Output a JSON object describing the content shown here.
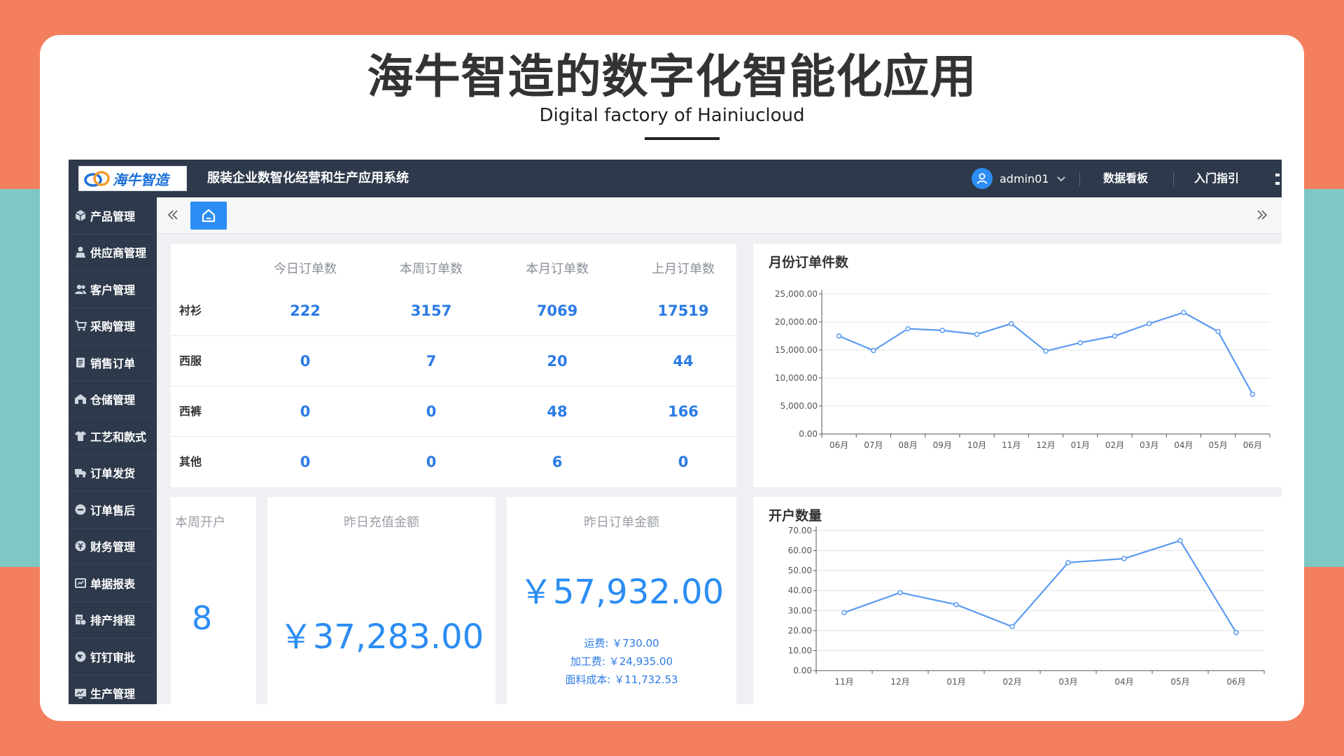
{
  "slide": {
    "headline": "海牛智造的数字化智能化应用",
    "subtitle": "Digital factory of Hainiucloud"
  },
  "app": {
    "logo_text": "海牛智造",
    "system_title": "服装企业数智化经营和生产应用系统",
    "user_name": "admin01",
    "nav_links": [
      "数据看板",
      "入门指引"
    ]
  },
  "sidebar": {
    "items": [
      {
        "label": "产品管理",
        "icon": "box-icon"
      },
      {
        "label": "供应商管理",
        "icon": "person-icon"
      },
      {
        "label": "客户管理",
        "icon": "users-icon"
      },
      {
        "label": "采购管理",
        "icon": "cart-icon"
      },
      {
        "label": "销售订单",
        "icon": "document-icon"
      },
      {
        "label": "仓储管理",
        "icon": "warehouse-icon"
      },
      {
        "label": "工艺和款式",
        "icon": "shirt-icon"
      },
      {
        "label": "订单发货",
        "icon": "truck-icon"
      },
      {
        "label": "订单售后",
        "icon": "minus-circle-icon"
      },
      {
        "label": "财务管理",
        "icon": "finance-icon"
      },
      {
        "label": "单据报表",
        "icon": "report-icon"
      },
      {
        "label": "排产排程",
        "icon": "schedule-icon"
      },
      {
        "label": "钉钉审批",
        "icon": "dingtalk-icon"
      },
      {
        "label": "生产管理",
        "icon": "production-icon"
      }
    ]
  },
  "orders_table": {
    "headers": [
      "今日订单数",
      "本周订单数",
      "本月订单数",
      "上月订单数"
    ],
    "rows": [
      {
        "label": "衬衫",
        "values": [
          "222",
          "3157",
          "7069",
          "17519"
        ]
      },
      {
        "label": "西服",
        "values": [
          "0",
          "7",
          "20",
          "44"
        ]
      },
      {
        "label": "西裤",
        "values": [
          "0",
          "0",
          "48",
          "166"
        ]
      },
      {
        "label": "其他",
        "values": [
          "0",
          "0",
          "6",
          "0"
        ]
      }
    ]
  },
  "stats": {
    "weekly_accounts_label": "本周开户",
    "weekly_accounts_value": "8",
    "recharge_label": "昨日充值金额",
    "recharge_value": "￥37,283.00",
    "order_amount_label": "昨日订单金额",
    "order_amount_value": "￥57,932.00",
    "order_breakdown": [
      "运费: ￥730.00",
      "加工费: ￥24,935.00",
      "面料成本: ￥11,732.53"
    ]
  },
  "colors": {
    "accent": "#2c8df4",
    "value_blue": "#2c7be5",
    "line": "#5b9bf0",
    "sidebar": "#2e3a4b",
    "background_coral": "#f47f5e",
    "background_teal": "#7fc7c4"
  },
  "chart_data": [
    {
      "type": "line",
      "title": "月份订单件数",
      "categories": [
        "06月",
        "07月",
        "08月",
        "09月",
        "10月",
        "11月",
        "12月",
        "01月",
        "02月",
        "03月",
        "04月",
        "05月",
        "06月"
      ],
      "y_tick_labels": [
        "0.00",
        "5,000.00",
        "10,000.00",
        "15,000.00",
        "20,000.00",
        "25,000.00"
      ],
      "values": [
        17500,
        14900,
        18800,
        18500,
        17800,
        19700,
        14800,
        16300,
        17500,
        19700,
        21700,
        18300,
        7100
      ],
      "ylim": [
        0,
        25000
      ],
      "grid": true,
      "legend": "none"
    },
    {
      "type": "line",
      "title": "开户数量",
      "categories": [
        "11月",
        "12月",
        "01月",
        "02月",
        "03月",
        "04月",
        "05月",
        "06月"
      ],
      "y_tick_labels": [
        "0.00",
        "10.00",
        "20.00",
        "30.00",
        "40.00",
        "50.00",
        "60.00",
        "70.00"
      ],
      "values": [
        29,
        39,
        33,
        22,
        54,
        56,
        65,
        19
      ],
      "ylim": [
        0,
        70
      ],
      "grid": true,
      "legend": "none"
    }
  ]
}
